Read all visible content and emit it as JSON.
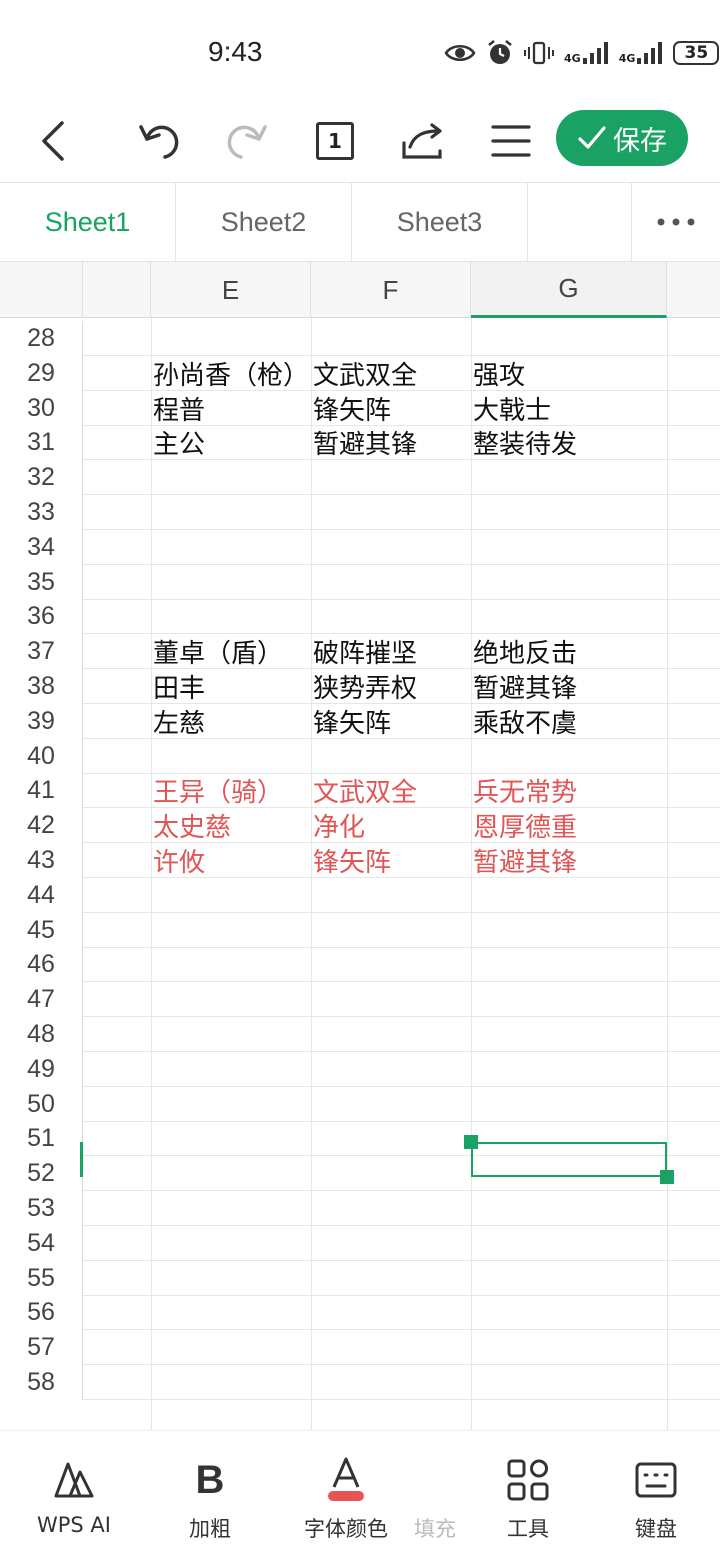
{
  "status_bar": {
    "time": "9:43",
    "signal1_label": "4G",
    "signal2_label": "4G",
    "battery": "35"
  },
  "toolbar": {
    "page_count": "1",
    "save_label": "保存"
  },
  "sheet_tabs": [
    "Sheet1",
    "Sheet2",
    "Sheet3"
  ],
  "columns": [
    "E",
    "F",
    "G"
  ],
  "selected_column": "G",
  "rows": [
    {
      "num": "28",
      "e": "",
      "f": "",
      "g": "",
      "red": false
    },
    {
      "num": "29",
      "e": "孙尚香（枪）",
      "f": "文武双全",
      "g": "强攻",
      "red": false
    },
    {
      "num": "30",
      "e": "程普",
      "f": "锋矢阵",
      "g": "大戟士",
      "red": false
    },
    {
      "num": "31",
      "e": "主公",
      "f": "暂避其锋",
      "g": "整装待发",
      "red": false
    },
    {
      "num": "32",
      "e": "",
      "f": "",
      "g": "",
      "red": false
    },
    {
      "num": "33",
      "e": "",
      "f": "",
      "g": "",
      "red": false
    },
    {
      "num": "34",
      "e": "",
      "f": "",
      "g": "",
      "red": false
    },
    {
      "num": "35",
      "e": "",
      "f": "",
      "g": "",
      "red": false
    },
    {
      "num": "36",
      "e": "",
      "f": "",
      "g": "",
      "red": false
    },
    {
      "num": "37",
      "e": "董卓（盾）",
      "f": "破阵摧坚",
      "g": "绝地反击",
      "red": false
    },
    {
      "num": "38",
      "e": "田丰",
      "f": "狭势弄权",
      "g": "暂避其锋",
      "red": false
    },
    {
      "num": "39",
      "e": "左慈",
      "f": "锋矢阵",
      "g": "乘敌不虞",
      "red": false
    },
    {
      "num": "40",
      "e": "",
      "f": "",
      "g": "",
      "red": false
    },
    {
      "num": "41",
      "e": "王异（骑）",
      "f": "文武双全",
      "g": "兵无常势",
      "red": true
    },
    {
      "num": "42",
      "e": "太史慈",
      "f": "净化",
      "g": "恩厚德重",
      "red": true
    },
    {
      "num": "43",
      "e": "许攸",
      "f": "锋矢阵",
      "g": "暂避其锋",
      "red": true
    },
    {
      "num": "44",
      "e": "",
      "f": "",
      "g": "",
      "red": false
    },
    {
      "num": "45",
      "e": "",
      "f": "",
      "g": "",
      "red": false
    },
    {
      "num": "46",
      "e": "",
      "f": "",
      "g": "",
      "red": false
    },
    {
      "num": "47",
      "e": "",
      "f": "",
      "g": "",
      "red": false
    },
    {
      "num": "48",
      "e": "",
      "f": "",
      "g": "",
      "red": false
    },
    {
      "num": "49",
      "e": "",
      "f": "",
      "g": "",
      "red": false
    },
    {
      "num": "50",
      "e": "",
      "f": "",
      "g": "",
      "red": false
    },
    {
      "num": "51",
      "e": "",
      "f": "",
      "g": "",
      "red": false
    },
    {
      "num": "52",
      "e": "",
      "f": "",
      "g": "",
      "red": false
    },
    {
      "num": "53",
      "e": "",
      "f": "",
      "g": "",
      "red": false
    },
    {
      "num": "54",
      "e": "",
      "f": "",
      "g": "",
      "red": false
    },
    {
      "num": "55",
      "e": "",
      "f": "",
      "g": "",
      "red": false
    },
    {
      "num": "56",
      "e": "",
      "f": "",
      "g": "",
      "red": false
    },
    {
      "num": "57",
      "e": "",
      "f": "",
      "g": "",
      "red": false
    },
    {
      "num": "58",
      "e": "",
      "f": "",
      "g": "",
      "red": false
    }
  ],
  "selected_row": "51",
  "bottom_bar": {
    "wps_ai": "WPS AI",
    "bold": "加粗",
    "font_color": "字体颜色",
    "fill": "填充",
    "tools": "工具",
    "keyboard": "键盘"
  },
  "colors": {
    "accent": "#1aa265",
    "red_text": "#e05555",
    "font_color_bar": "#e85454"
  }
}
